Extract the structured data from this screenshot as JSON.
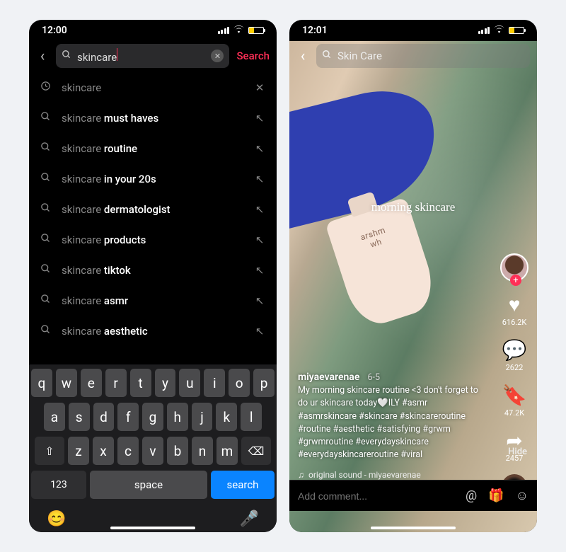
{
  "left": {
    "time": "12:00",
    "search_value": "skincare",
    "search_action": "Search",
    "suggestions": [
      {
        "icon": "hist",
        "base": "skincare",
        "bold": "",
        "tail": "x"
      },
      {
        "icon": "mag",
        "base": "skincare ",
        "bold": "must haves",
        "tail": "↖"
      },
      {
        "icon": "mag",
        "base": "skincare ",
        "bold": "routine",
        "tail": "↖"
      },
      {
        "icon": "mag",
        "base": "skincare ",
        "bold": "in your 20s",
        "tail": "↖"
      },
      {
        "icon": "mag",
        "base": "skincare ",
        "bold": "dermatologist",
        "tail": "↖"
      },
      {
        "icon": "mag",
        "base": "skincare ",
        "bold": "products",
        "tail": "↖"
      },
      {
        "icon": "mag",
        "base": "skincare ",
        "bold": "tiktok",
        "tail": "↖"
      },
      {
        "icon": "mag",
        "base": "skincare ",
        "bold": "asmr",
        "tail": "↖"
      },
      {
        "icon": "mag",
        "base": "skincare ",
        "bold": "aesthetic",
        "tail": "↖"
      }
    ],
    "keyboard": {
      "row1": [
        "q",
        "w",
        "e",
        "r",
        "t",
        "y",
        "u",
        "i",
        "o",
        "p"
      ],
      "row2": [
        "a",
        "s",
        "d",
        "f",
        "g",
        "h",
        "j",
        "k",
        "l"
      ],
      "row3_mid": [
        "z",
        "x",
        "c",
        "v",
        "b",
        "n",
        "m"
      ],
      "shift": "⇧",
      "bksp": "⌫",
      "numkey": "123",
      "space": "space",
      "go": "search",
      "emoji": "😊",
      "mic": "🎤"
    }
  },
  "right": {
    "time": "12:01",
    "search_value": "Skin Care",
    "overlay_title": "morning skincare",
    "bottle_line1": "arshm",
    "bottle_line2": "wh",
    "rail": {
      "likes": "616.2K",
      "comments": "2622",
      "saves": "47.2K",
      "shares": "2457"
    },
    "username": "miyaevarenae",
    "date": "6-5",
    "caption": "My morning skincare routine <3 don't forget to do ur skincare today🤍ILY #asmr #asmrskincare #skincare #skincareroutine #routine #aesthetic #satisfying #grwm #grwmroutine #everydayskincare #everydayskincareroutine #viral",
    "hide": "Hide",
    "sound": "original sound - miyaevarenae",
    "comment_placeholder": "Add comment..."
  }
}
